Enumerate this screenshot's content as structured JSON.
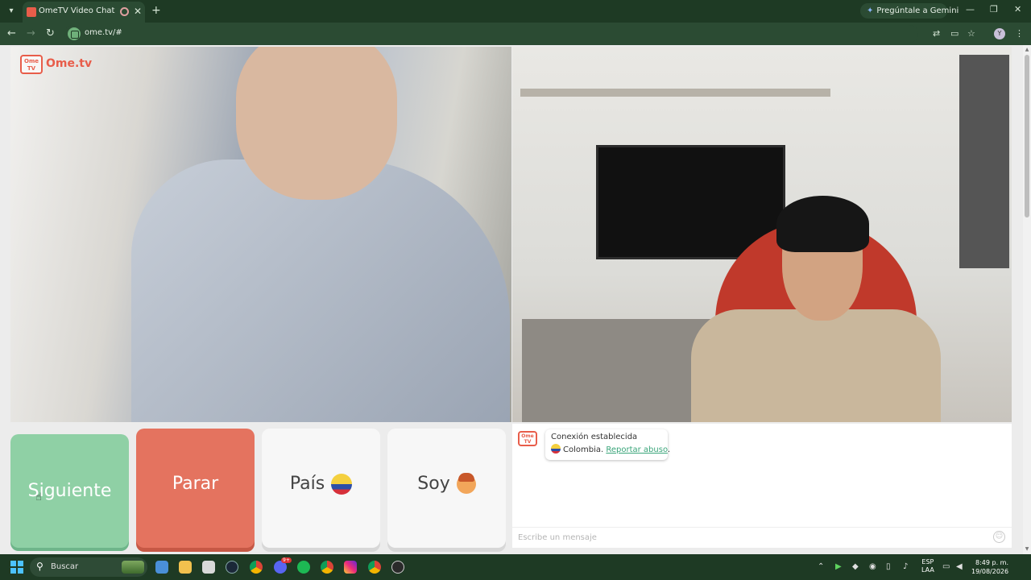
{
  "browser": {
    "tab_title": "OmeTV Video Chat — Ome",
    "tab_close": "✕",
    "new_tab": "+",
    "gemini_label": "Pregúntale a Gemini",
    "url": "ome.tv/#",
    "profile_initial": "Y",
    "win_minimize": "—",
    "win_restore": "❐",
    "win_close": "✕"
  },
  "site": {
    "logo_box": "Ome TV",
    "logo_text": "Ome.tv"
  },
  "buttons": {
    "next_label": "Siguiente",
    "stop_label": "Parar",
    "country_label": "País",
    "soy_label": "Soy"
  },
  "chat": {
    "logo": "Ome TV",
    "connection_text": "Conexión establecida",
    "country": "Colombia.",
    "report_link": "Reportar abuso",
    "report_suffix": ".",
    "input_placeholder": "Escribe un mensaje",
    "emoji": "☺"
  },
  "taskbar": {
    "search_label": "Buscar",
    "lang_top": "ESP",
    "lang_bottom": "LAA",
    "time": "8:49 p. m.",
    "date": "19/08/2026",
    "badge": "9+"
  },
  "colors": {
    "brand": "#e85d4a",
    "next_button": "#8fd0a5",
    "stop_button": "#e4735f",
    "chrome_bg": "#1e3a24",
    "report_link": "#3aa57a"
  }
}
